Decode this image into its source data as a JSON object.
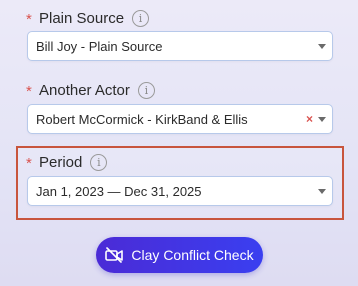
{
  "fields": [
    {
      "label": "Plain Source",
      "required_mark": "*",
      "info_mark": "i",
      "value": "Bill Joy - Plain Source"
    },
    {
      "label": "Another Actor",
      "required_mark": "*",
      "info_mark": "i",
      "value": "Robert McCormick - KirkBand & Ellis",
      "clear_mark": "×"
    },
    {
      "label": "Period",
      "required_mark": "*",
      "info_mark": "i",
      "value": "Jan 1, 2023 — Dec 31, 2025"
    }
  ],
  "action_button": {
    "label": "Clay Conflict Check",
    "icon": "no-video-icon"
  },
  "colors": {
    "required": "#d9534f",
    "highlight_border": "#c8553d",
    "button_start": "#4b2bd6",
    "button_end": "#3a3ff0",
    "select_border": "#b7c9ea"
  }
}
